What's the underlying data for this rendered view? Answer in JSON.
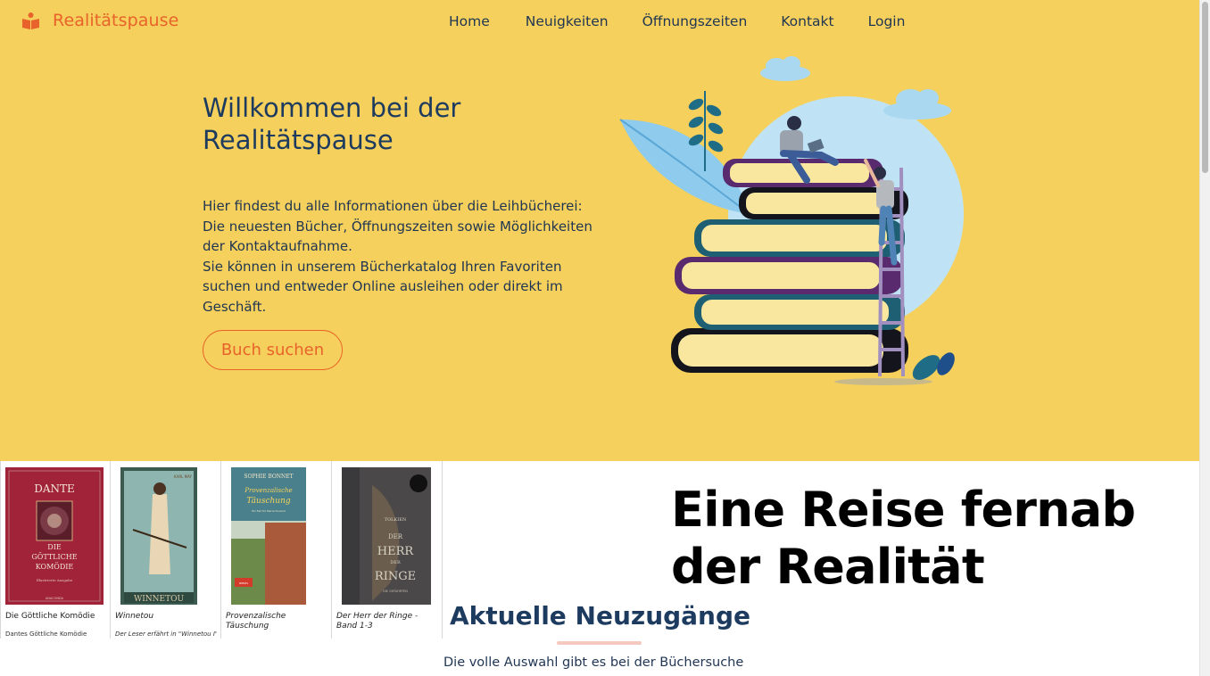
{
  "brand": {
    "name": "Realitätspause",
    "icon": "open-box-icon",
    "color": "#e8632b"
  },
  "nav": {
    "home": "Home",
    "news": "Neuigkeiten",
    "hours": "Öffnungszeiten",
    "contact": "Kontakt",
    "login": "Login"
  },
  "hero": {
    "title": "Willkommen bei der Realitätspause",
    "text": "Hier findest du alle Informationen über die Leihbücherei:\nDie neuesten Bücher, Öffnungszeiten sowie Möglichkeiten der Kontaktaufnahme.\nSie können in unserem Bücherkatalog Ihren Favoriten suchen und entweder Online ausleihen oder direkt im Geschäft.",
    "button": "Buch suchen",
    "background": "#f5d05c"
  },
  "books": [
    {
      "title": "Die Göttliche Komödie",
      "desc": "Dantes Göttliche Komödie",
      "cover_author": "DANTE",
      "cover_title": "DIE GÖTTLICHE KOMÖDIE",
      "cover_sub": "Illustrierte Ausgabe",
      "cover_publisher": "ANACONDA",
      "italic": false
    },
    {
      "title": "Winnetou",
      "desc": "Der Leser erfährt in \"Winnetou I\",",
      "cover_author": "KARL MAY",
      "cover_title": "WINNETOU",
      "italic": true
    },
    {
      "title": "Provenzalische Täuschung",
      "desc": "",
      "cover_author": "SOPHIE BONNET",
      "cover_title": "Provenzalische Täuschung",
      "cover_sub": "Ein Fall für Pierre Durand",
      "cover_badge": "SPIEGEL Bestseller",
      "italic": true
    },
    {
      "title": "Der Herr der Ringe - Band 1-3",
      "desc": "",
      "cover_author": "TOLKIEN",
      "cover_title": "DER HERR DER RINGE",
      "cover_sub": "DIE GEFÄHRTEN",
      "italic": true
    }
  ],
  "headline": "Eine Reise fernab der Realität",
  "section": {
    "title": "Aktuelle Neuzugänge",
    "subtitle": "Die volle Auswahl gibt es bei der Büchersuche"
  },
  "illustration_icon": "book-stack-ladder-illustration"
}
